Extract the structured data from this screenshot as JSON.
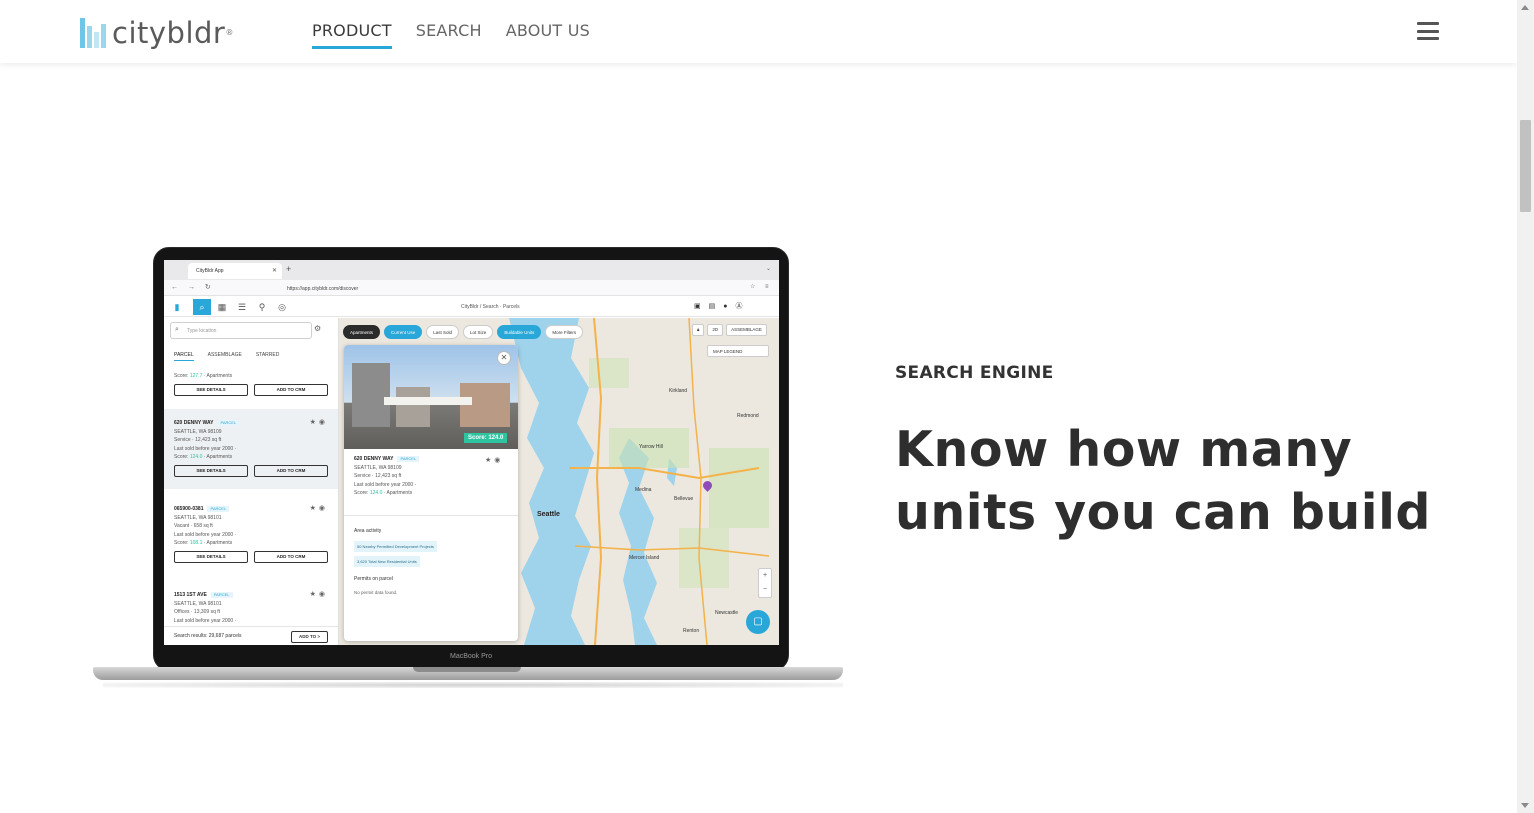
{
  "brand": {
    "name": "citybldr",
    "reg": "®",
    "accent": "#2aa7d9"
  },
  "nav": {
    "items": [
      "PRODUCT",
      "SEARCH",
      "ABOUT US"
    ],
    "active": "PRODUCT"
  },
  "section": {
    "eyebrow": "SEARCH ENGINE",
    "headline": "Know how many units you can build"
  },
  "laptop": {
    "model_label": "MacBook Pro",
    "browser": {
      "tab_title": "CityBldr App",
      "url": "https://app.citybldr.com/discover"
    },
    "app": {
      "breadcrumb": "CityBldr  /  Search · Parcels",
      "search_placeholder": "Type location",
      "tabs": [
        "PARCEL",
        "ASSEMBLAGE",
        "STARRED"
      ],
      "buttons": {
        "details": "SEE DETAILS",
        "crm": "ADD TO CRM",
        "add_to": "ADD TO  >"
      },
      "results": [
        {
          "score_prefix": "Score:",
          "score": "127.7",
          "use": "· Apartments"
        },
        {
          "title": "620 DENNY WAY",
          "tag": "PARCEL",
          "city": "SEATTLE, WA 98109",
          "detail": "Service · 12,423 sq ft",
          "sold": "Last sold before year 2000 ·",
          "score_prefix": "Score:",
          "score": "124.0",
          "use": "· Apartments"
        },
        {
          "title": "065900-0381",
          "tag": "PARCEL",
          "city": "SEATTLE, WA 98101",
          "detail": "Vacant · 658 sq ft",
          "sold": "Last sold before year 2000 ·",
          "score_prefix": "Score:",
          "score": "108.1",
          "use": "· Apartments"
        },
        {
          "title": "1513 1ST AVE",
          "tag": "PARCEL",
          "city": "SEATTLE, WA 98101",
          "detail": "Offices · 13,309 sq ft",
          "sold": "Last sold before year 2000 ·"
        }
      ],
      "results_count": "Search results: 29,687 parcels",
      "filters": [
        "Apartments",
        "Current Use",
        "Last Sold",
        "Lot Size",
        "Buildable Units",
        "More Filters"
      ],
      "map_controls": [
        "2D",
        "ASSEMBLAGE"
      ],
      "map_legend": "MAP LEGEND",
      "cities": [
        "Kirkland",
        "Redmond",
        "Yarrow Hill",
        "Medina",
        "Bellevue",
        "Seattle",
        "Mercer Island",
        "Newcastle",
        "Renton"
      ],
      "popup": {
        "score_badge": "Score: 124.0",
        "title": "620 DENNY WAY",
        "tag": "PARCEL",
        "city": "SEATTLE, WA 98109",
        "detail": "Service · 12,423 sq ft",
        "sold": "Last sold before year 2000 ·",
        "score_prefix": "Score:",
        "score": "124.0",
        "use": "· Apartments",
        "area_heading": "Area activity",
        "pill1": "50 Nearby Permitted Development Projects",
        "pill2": "3,620 Total New Residential Units",
        "permits_heading": "Permits on parcel",
        "permits_text": "No permit data found."
      }
    }
  }
}
